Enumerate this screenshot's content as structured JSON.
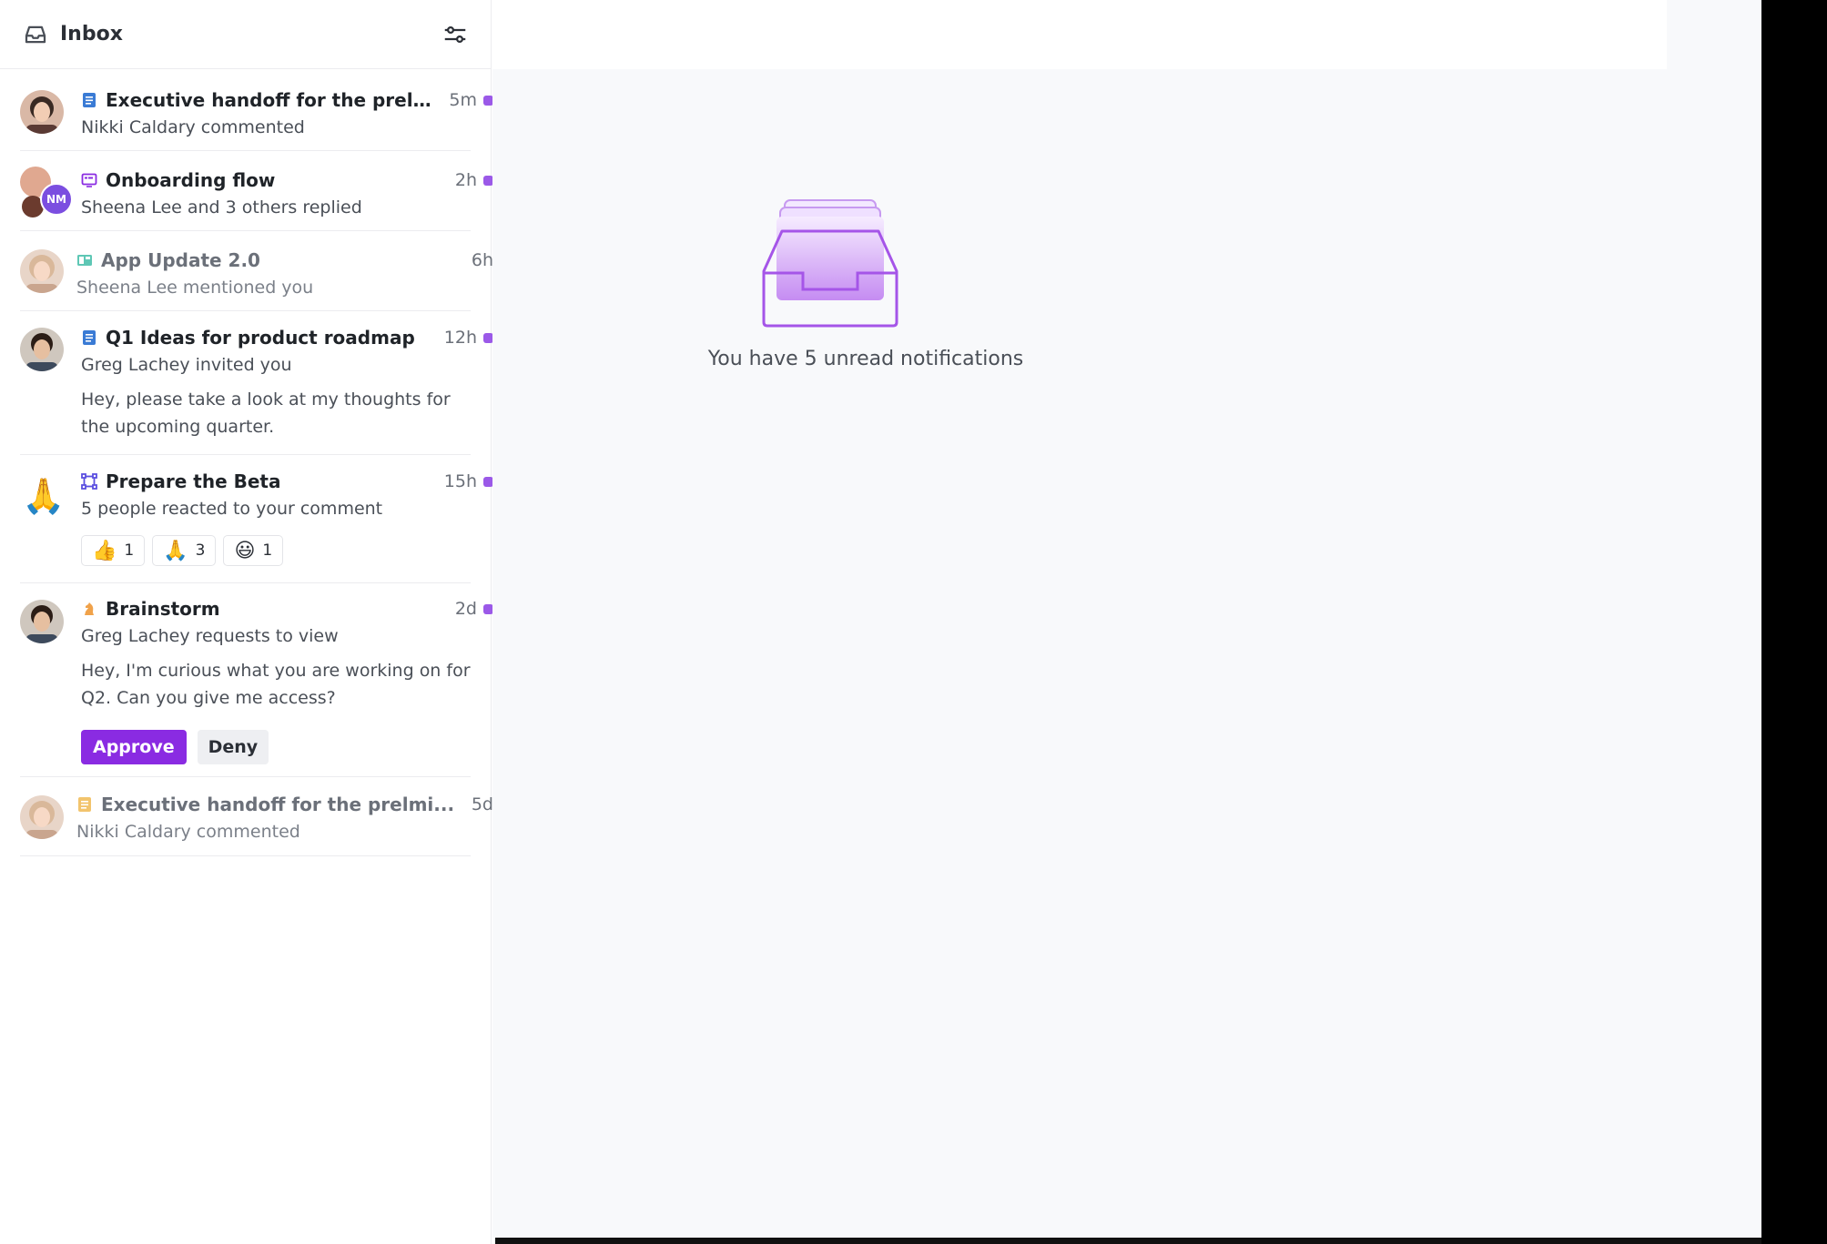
{
  "sidebar": {
    "title": "Inbox",
    "items": [
      {
        "title": "Executive handoff for the prelmi...",
        "subtitle": "Nikki Caldary commented",
        "time": "5m",
        "unread": true
      },
      {
        "title": "Onboarding flow",
        "subtitle": "Sheena Lee and 3 others replied",
        "time": "2h",
        "unread": true,
        "badge": "NM"
      },
      {
        "title": "App Update 2.0",
        "subtitle": "Sheena Lee mentioned you",
        "time": "6h",
        "unread": false
      },
      {
        "title": "Q1 Ideas for product roadmap",
        "subtitle": "Greg Lachey invited you",
        "time": "12h",
        "unread": true,
        "message": "Hey, please take a look at my thoughts for the upcoming quarter."
      },
      {
        "title": "Prepare the Beta",
        "subtitle": "5 people reacted to your comment",
        "time": "15h",
        "unread": true,
        "avatar_emoji": "🙏",
        "reactions": [
          {
            "emoji": "👍",
            "count": "1"
          },
          {
            "emoji": "🙏",
            "count": "3"
          },
          {
            "emoji": "😃",
            "count": "1"
          }
        ]
      },
      {
        "title": "Brainstorm",
        "subtitle": "Greg Lachey requests to view",
        "time": "2d",
        "unread": true,
        "message": "Hey, I'm curious what you are working on for Q2. Can you give me access?",
        "approve_label": "Approve",
        "deny_label": "Deny"
      },
      {
        "title": "Executive handoff for the prelmi...",
        "subtitle": "Nikki Caldary commented",
        "time": "5d",
        "unread": false
      }
    ]
  },
  "main": {
    "empty_message": "You have 5 unread notifications"
  },
  "colors": {
    "accent": "#8a2be2",
    "unread_dot": "#9b59e8",
    "doc_blue": "#3a7bd5",
    "doc_yellow": "#f2c46d"
  }
}
